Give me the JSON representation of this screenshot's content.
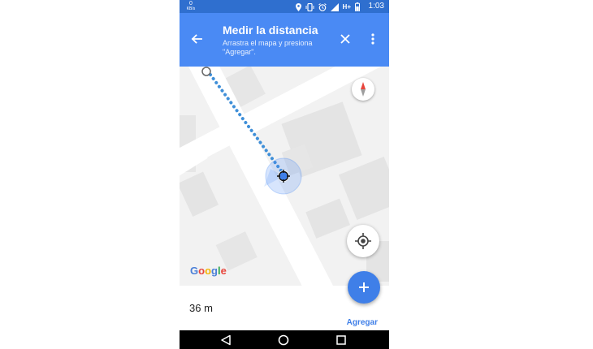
{
  "status_bar": {
    "network_speed": "0",
    "network_speed_unit": "KB/s",
    "network_type": "H+",
    "time": "1:03",
    "icons": [
      "location-icon",
      "vibrate-icon",
      "alarm-icon",
      "signal-icon",
      "hplus-icon",
      "battery-icon"
    ]
  },
  "app_bar": {
    "title": "Medir la distancia",
    "subtitle": "Arrastra el mapa y presiona \"Agregar\".",
    "back_icon": "arrow-back-icon",
    "close_icon": "close-icon",
    "more_icon": "more-vert-icon",
    "color": "#4a8af4"
  },
  "map": {
    "logo_text": "Google",
    "measure_line_color": "#3f8fd8",
    "start_marker_icon": "start-point-icon",
    "crosshair_icon": "crosshair-icon",
    "compass_icon": "compass-icon",
    "my_location_icon": "my-location-icon"
  },
  "bottom_panel": {
    "distance": "36 m",
    "add_label": "Agregar",
    "fab_icon": "plus-icon",
    "accent_color": "#3f7fe8"
  },
  "nav_bar": {
    "icons": [
      "nav-back-icon",
      "nav-home-icon",
      "nav-recent-icon"
    ]
  }
}
